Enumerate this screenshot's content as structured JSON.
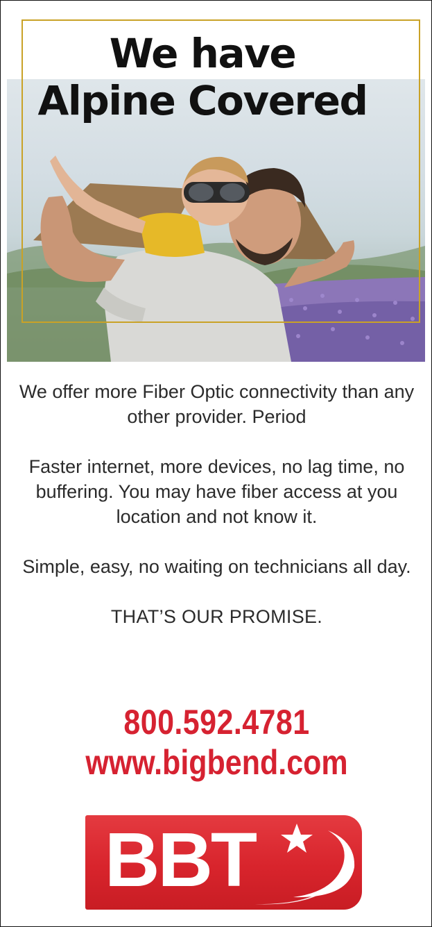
{
  "headline": {
    "line1": "We have",
    "line2": "Alpine Covered"
  },
  "body": {
    "para1": "We offer more Fiber Optic connectivity than any other provider. Period",
    "para2": "Faster internet, more devices, no lag time, no buffering. You may have fiber access at you location and not know it.",
    "para3": "Simple, easy, no waiting on technicians all day.",
    "promise": "THAT’S OUR PROMISE."
  },
  "contact": {
    "phone": "800.592.4781",
    "website": "www.bigbend.com"
  },
  "logo": {
    "text": "BBT",
    "icon": "star-swoosh-icon"
  },
  "colors": {
    "accent_red": "#d62231",
    "frame_gold": "#c9a227",
    "headline_black": "#111111"
  }
}
